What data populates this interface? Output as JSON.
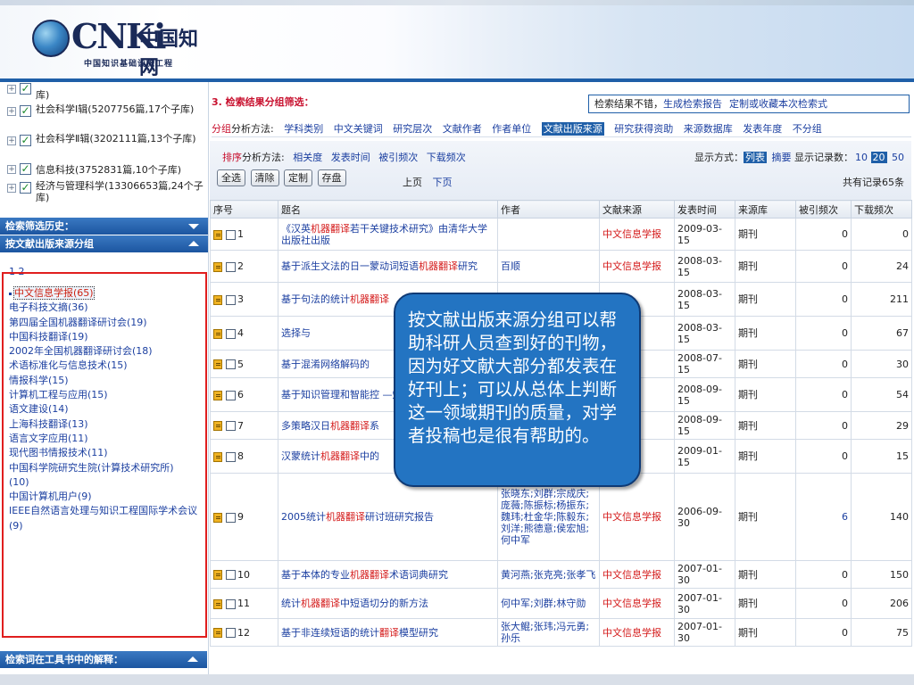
{
  "header": {
    "logo_main": "CNKi",
    "logo_cn": "中国知网",
    "logo_sub": "中国知识基础设施工程"
  },
  "sidebar": {
    "categories": [
      {
        "label": "库)"
      },
      {
        "label": "社会科学Ⅰ辑(5207756篇,17个子库)"
      },
      {
        "label": "社会科学Ⅱ辑(3202111篇,13个子库)"
      },
      {
        "label": "信息科技(3752831篇,10个子库)"
      },
      {
        "label": "经济与管理科学(13306653篇,24个子库)"
      }
    ],
    "history_title": "检索筛选历史：",
    "source_group_title": "按文献出版来源分组",
    "pages": "1 2",
    "sources": [
      "中文信息学报(65)",
      "电子科技文摘(36)",
      "第四届全国机器翻译研讨会(19)",
      "中国科技翻译(19)",
      "2002年全国机器翻译研讨会(18)",
      "术语标准化与信息技术(15)",
      "情报科学(15)",
      "计算机工程与应用(15)",
      "语文建设(14)",
      "上海科技翻译(13)",
      "语言文字应用(11)",
      "现代图书情报技术(11)",
      "中国科学院研究生院(计算技术研究所)(10)",
      "中国计算机用户(9)",
      "IEEE自然语言处理与知识工程国际学术会议(9)"
    ],
    "toolbook_title": "检索词在工具书中的解释："
  },
  "filter": {
    "title": "3. 检索结果分组筛选：",
    "report_lead": "检索结果不错，",
    "report_links": [
      "生成检索报告",
      "定制或收藏本次检索式"
    ],
    "method_red": "分组",
    "method_label": "分析方法:",
    "methods": [
      "学科类别",
      "中文关键词",
      "研究层次",
      "文献作者",
      "作者单位",
      "文献出版来源",
      "研究获得资助",
      "来源数据库",
      "发表年度",
      "不分组"
    ],
    "active_method": "文献出版来源"
  },
  "sort": {
    "red": "排序",
    "label": "分析方法:",
    "options": [
      "相关度",
      "发表时间",
      "被引频次",
      "下载频次"
    ],
    "display_label": "显示方式：",
    "display_active": "列表",
    "display_other": "摘要",
    "count_label": "显示记录数：",
    "counts": [
      "10",
      "20",
      "50"
    ],
    "count_active": "20",
    "buttons": [
      "全选",
      "清除",
      "定制",
      "存盘"
    ],
    "prev": "上页",
    "next": "下页",
    "total": "共有记录65条"
  },
  "table": {
    "headers": [
      "序号",
      "题名",
      "作者",
      "文献来源",
      "发表时间",
      "来源库",
      "被引频次",
      "下载频次"
    ],
    "rows": [
      {
        "no": "1",
        "title": "《汉英机器翻译若干关键技术研究》由清华大学出版社出版",
        "author": "",
        "source": "中文信息学报",
        "date": "2009-03-15",
        "db": "期刊",
        "cited": "0",
        "downloads": "0"
      },
      {
        "no": "2",
        "title": "基于派生文法的日一蒙动词短语机器翻译研究",
        "author": "百顺",
        "source": "中文信息学报",
        "date": "2008-03-15",
        "db": "期刊",
        "cited": "0",
        "downloads": "24"
      },
      {
        "no": "3",
        "title": "基于句法的统计机器翻译",
        "author": "",
        "source": "学报",
        "date": "2008-03-15",
        "db": "期刊",
        "cited": "0",
        "downloads": "211"
      },
      {
        "no": "4",
        "title": "选择与",
        "author": "",
        "source": "学报",
        "date": "2008-03-15",
        "db": "期刊",
        "cited": "0",
        "downloads": "67"
      },
      {
        "no": "5",
        "title": "基于混淆网络解码的",
        "author": "",
        "source": "学报",
        "date": "2008-07-15",
        "db": "期刊",
        "cited": "0",
        "downloads": "30"
      },
      {
        "no": "6",
        "title": "基于知识管理和智能控 —知识管理和机器翻译",
        "author": "",
        "source": "学报",
        "date": "2008-09-15",
        "db": "期刊",
        "cited": "0",
        "downloads": "54"
      },
      {
        "no": "7",
        "title": "多策略汉日机器翻译系",
        "author": "",
        "source": "学报",
        "date": "2008-09-15",
        "db": "期刊",
        "cited": "0",
        "downloads": "29"
      },
      {
        "no": "8",
        "title": "汉蒙统计机器翻译中的",
        "author": "",
        "source": "学报",
        "date": "2009-01-15",
        "db": "期刊",
        "cited": "0",
        "downloads": "15"
      },
      {
        "no": "9",
        "title": "2005统计机器翻译研讨班研究报告",
        "author": "张晓东;刘群;宗成庆;庞薇;陈振标;杨振东;魏玮;杜金华;陈毅东;刘洋;熊德意;侯宏旭;何中军",
        "source": "中文信息学报",
        "date": "2006-09-30",
        "db": "期刊",
        "cited": "6",
        "downloads": "140"
      },
      {
        "no": "10",
        "title": "基于本体的专业机器翻译术语词典研究",
        "author": "黄河燕;张克亮;张孝飞",
        "source": "中文信息学报",
        "date": "2007-01-30",
        "db": "期刊",
        "cited": "0",
        "downloads": "150"
      },
      {
        "no": "11",
        "title": "统计机器翻译中短语切分的新方法",
        "author": "何中军;刘群;林守勋",
        "source": "中文信息学报",
        "date": "2007-01-30",
        "db": "期刊",
        "cited": "0",
        "downloads": "206"
      },
      {
        "no": "12",
        "title": "基于非连续短语的统计翻译模型研究",
        "author": "张大鲲;张玮;冯元勇;孙乐",
        "source": "中文信息学报",
        "date": "2007-01-30",
        "db": "期刊",
        "cited": "0",
        "downloads": "75"
      }
    ]
  },
  "callout": {
    "text": "按文献出版来源分组可以帮助科研人员查到好的刊物，因为好文献大部分都发表在好刊上；可以从总体上判断这一领域期刊的质量，对学者投稿也是很有帮助的。"
  }
}
